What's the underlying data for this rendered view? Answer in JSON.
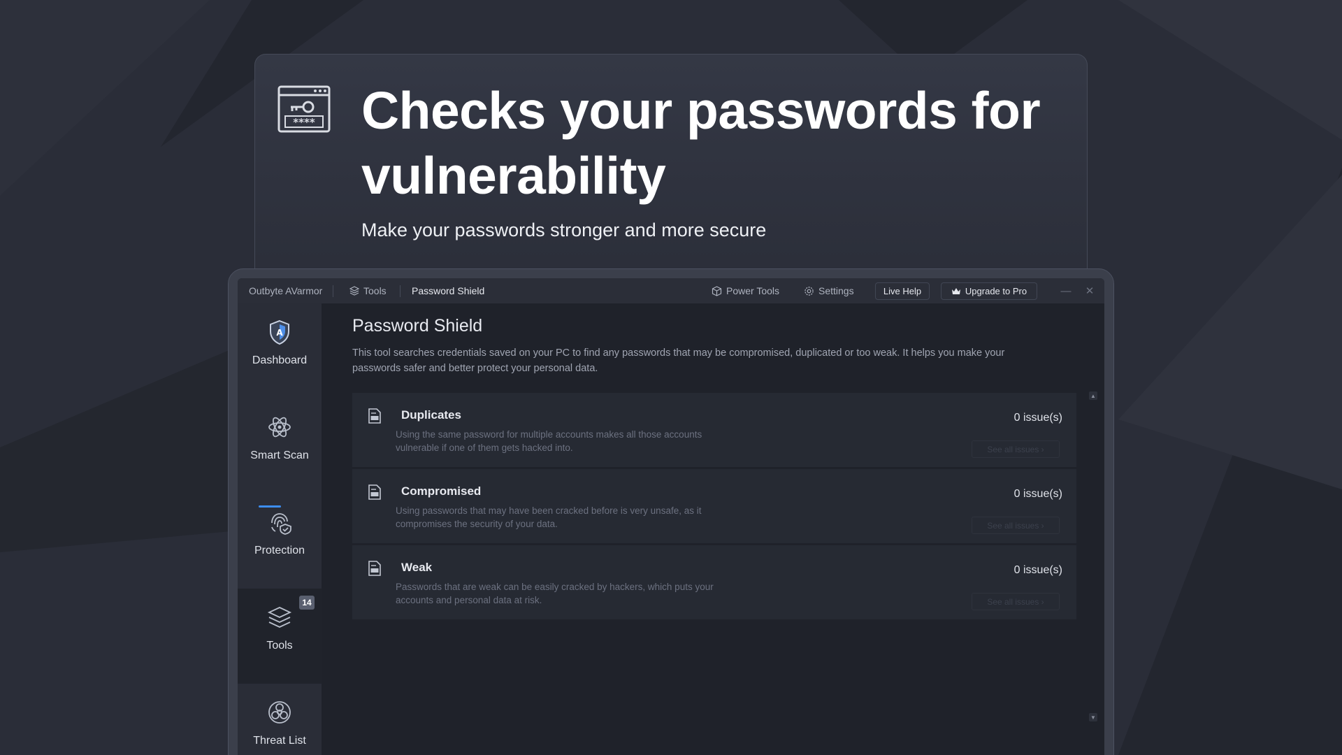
{
  "hero": {
    "title": "Checks your passwords for vulnerability",
    "subtitle": "Make your passwords stronger and more secure"
  },
  "titlebar": {
    "app_name": "Outbyte AVarmor",
    "breadcrumb": [
      "Tools",
      "Password Shield"
    ],
    "power_tools": "Power Tools",
    "settings": "Settings",
    "live_help": "Live Help",
    "upgrade": "Upgrade to Pro"
  },
  "sidebar": {
    "items": [
      {
        "label": "Dashboard",
        "icon": "shield-icon"
      },
      {
        "label": "Smart Scan",
        "icon": "atom-icon"
      },
      {
        "label": "Protection",
        "icon": "fingerprint-shield-icon"
      },
      {
        "label": "Tools",
        "icon": "layers-icon",
        "badge": "14"
      },
      {
        "label": "Threat List",
        "icon": "biohazard-icon"
      }
    ]
  },
  "main": {
    "title": "Password Shield",
    "description": "This tool searches credentials saved on your PC to find any passwords that may be compromised, duplicated or too weak. It helps you make your passwords safer and better protect your personal data.",
    "categories": [
      {
        "title": "Duplicates",
        "description": "Using the same password for multiple accounts makes all those accounts vulnerable if one of them gets hacked into.",
        "count": "0 issue(s)",
        "link": "See all issues ›"
      },
      {
        "title": "Compromised",
        "description": "Using passwords that may have been cracked before is very unsafe, as it compromises the security of your data.",
        "count": "0 issue(s)",
        "link": "See all issues ›"
      },
      {
        "title": "Weak",
        "description": "Passwords that are weak can be easily cracked by hackers, which puts your accounts and personal data at risk.",
        "count": "0 issue(s)",
        "link": "See all issues ›"
      }
    ]
  },
  "colors": {
    "background": "#2a2d38",
    "accent": "#3d8ef2",
    "content_bg": "#1f222a",
    "card_bg": "#262a33"
  }
}
